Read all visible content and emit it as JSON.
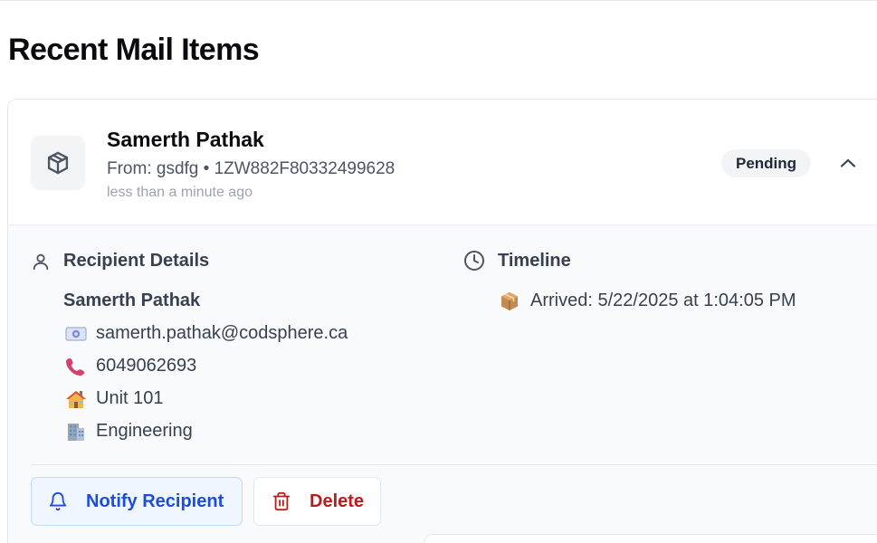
{
  "page": {
    "title": "Recent Mail Items"
  },
  "mail_item": {
    "recipient_name": "Samerth Pathak",
    "from_line": "From: gsdfg • 1ZW882F80332499628",
    "time_ago": "less than a minute ago",
    "status": "Pending",
    "icons": {
      "package": "package-icon",
      "collapse": "chevron-up-icon"
    }
  },
  "details": {
    "recipient_heading": "Recipient Details",
    "name": "Samerth Pathak",
    "email": "samerth.pathak@codsphere.ca",
    "phone": "6049062693",
    "unit": "Unit 101",
    "department": "Engineering",
    "icons": [
      "user-icon",
      "email-emoji",
      "phone-emoji",
      "house-emoji",
      "office-building-emoji"
    ]
  },
  "timeline": {
    "heading": "Timeline",
    "arrived": "Arrived: 5/22/2025 at 1:04:05 PM",
    "icons": [
      "clock-icon",
      "package-emoji"
    ]
  },
  "actions": {
    "notify_label": "Notify Recipient",
    "delete_label": "Delete",
    "icons": [
      "bell-icon",
      "trash-icon"
    ]
  },
  "colors": {
    "notify_text": "#1d4ed8",
    "notify_bg": "#eff6ff",
    "delete_text": "#b91c1c",
    "body_bg": "#f9fafb"
  }
}
